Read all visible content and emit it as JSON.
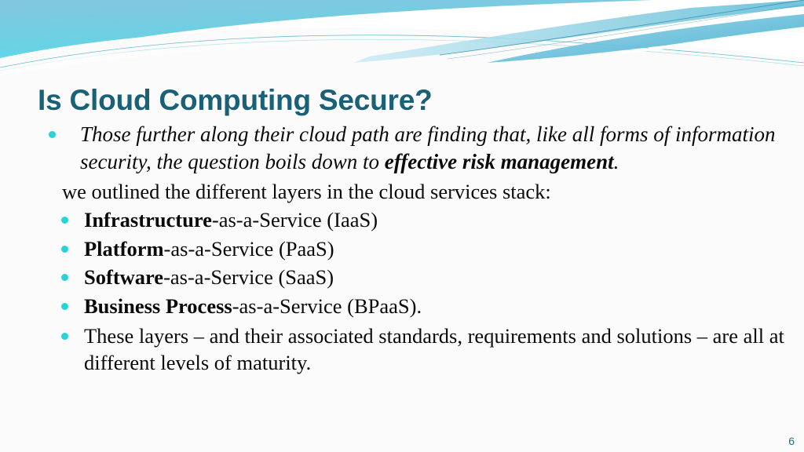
{
  "slide": {
    "title": "Is Cloud Computing Secure?",
    "page_number": "6",
    "colors": {
      "title": "#1a6076",
      "bullet": "#2ad2d8",
      "page_number": "#2c6b8a",
      "band_top": "#7fc4de",
      "band_bottom": "#5fd8e8",
      "background": "#fbfbfc"
    },
    "content": {
      "lead_bullet": {
        "text_before": "Those further along their cloud path are finding that, like all forms of information security, the question boils down to ",
        "emphasis": "effective risk management",
        "text_after": "."
      },
      "intro_line": "we outlined the different layers in the cloud services stack:",
      "service_layers": [
        {
          "term": "Infrastructure",
          "rest": "-as-a-Service (IaaS)"
        },
        {
          "term": "Platform",
          "rest": "-as-a-Service (PaaS)"
        },
        {
          "term": "Software",
          "rest": "-as-a-Service (SaaS)"
        },
        {
          "term": "Business Process",
          "rest": "-as-a-Service (BPaaS)."
        }
      ],
      "closing_bullet": "These layers – and their associated standards, requirements and solutions – are all at different levels of maturity."
    }
  }
}
